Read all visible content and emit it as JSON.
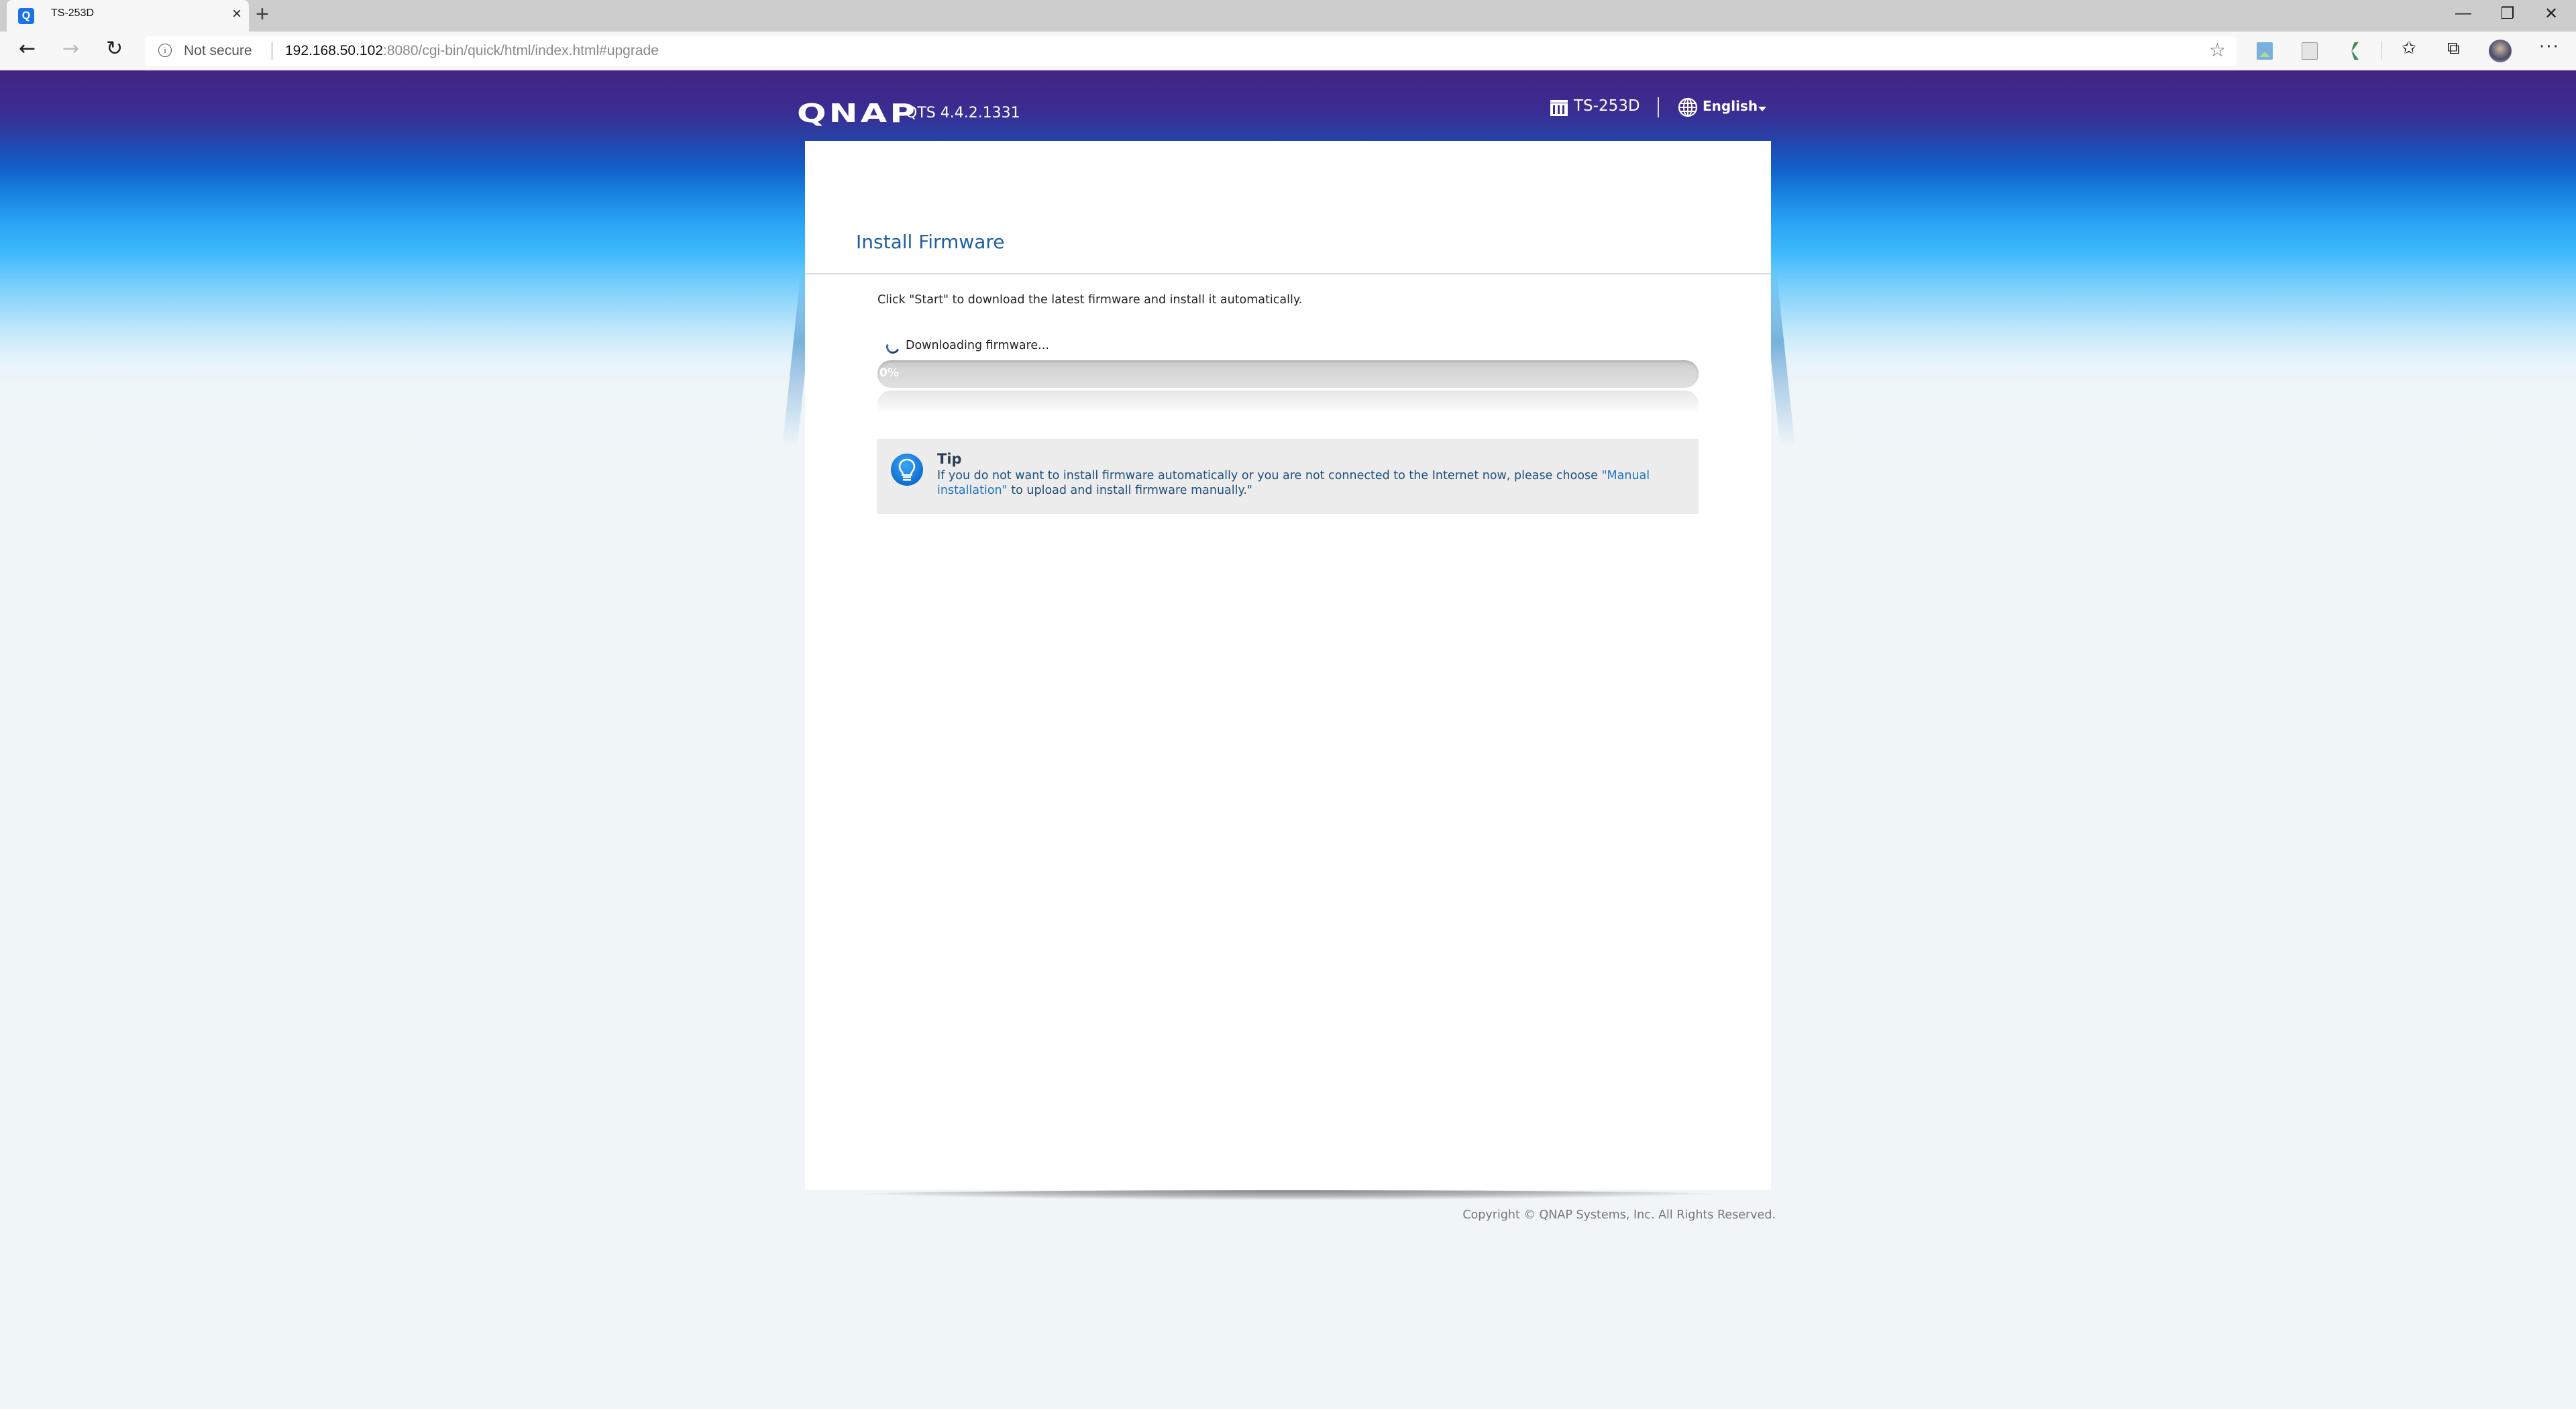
{
  "browser": {
    "tab": {
      "title": "TS-253D",
      "favicon_letter": "Q",
      "close_label": "×"
    },
    "new_tab_label": "+",
    "window_controls": {
      "minimize": "—",
      "restore": "❐",
      "close": "✕"
    },
    "nav": {
      "back": "←",
      "forward": "→",
      "reload": "↻"
    },
    "address": {
      "security_label": "Not secure",
      "info_glyph": "i",
      "url_host": "192.168.50.102",
      "url_rest": ":8080/cgi-bin/quick/html/index.html#upgrade"
    },
    "toolbar_icons": {
      "favorite_add": "☆",
      "favorites": "✩",
      "collections": "⧉",
      "more": "···"
    }
  },
  "header": {
    "brand": "QNAP",
    "version": "QTS 4.4.2.1331",
    "device_name": "TS-253D",
    "language": "English"
  },
  "card": {
    "title": "Install Firmware",
    "instruction": "Click \"Start\" to download the latest firmware and install it automatically.",
    "status": "Downloading firmware...",
    "progress": {
      "percent": 0,
      "label": "0%"
    },
    "tip": {
      "title": "Tip",
      "text_before": "If you do not want to install firmware automatically or you are not connected to the Internet now, please choose ",
      "link": "\"Manual installation\"",
      "text_after": " to upload and install firmware manually.\""
    }
  },
  "footer": {
    "copyright": "Copyright © QNAP Systems, Inc. All Rights Reserved."
  },
  "colors": {
    "header_purple": "#432483",
    "title_blue": "#1f5f9e",
    "link_blue": "#1e73be",
    "tip_bg": "#ececec"
  }
}
